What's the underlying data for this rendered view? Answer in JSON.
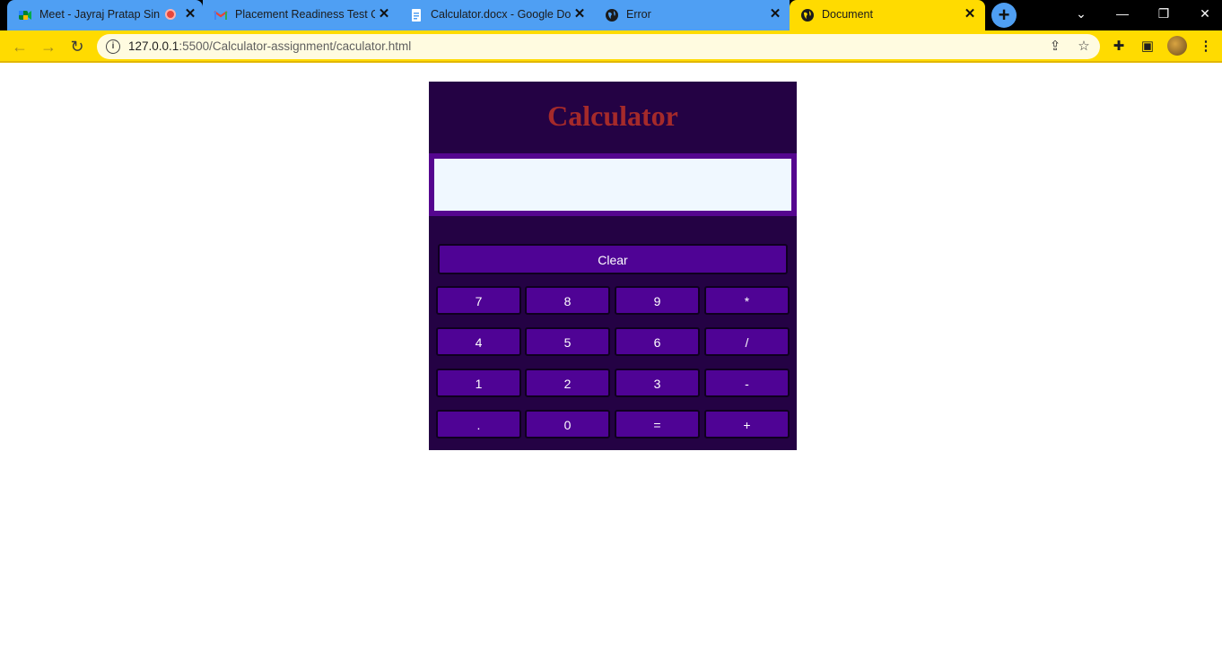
{
  "browser": {
    "tabs": [
      {
        "title": "Meet - Jayraj Pratap Singh",
        "icon": "google-meet-icon",
        "recording": true
      },
      {
        "title": "Placement Readiness Test Qu",
        "icon": "gmail-icon"
      },
      {
        "title": "Calculator.docx - Google Docs",
        "icon": "docs-icon"
      },
      {
        "title": "Error",
        "icon": "globe-icon"
      },
      {
        "title": "Document",
        "icon": "globe-icon",
        "active": true
      }
    ],
    "url_host": "127.0.0.1",
    "url_rest": ":5500/Calculator-assignment/caculator.html",
    "colors": {
      "tab_strip": "#000000",
      "tab": "#4f9ff3",
      "active_tab": "#ffdb00",
      "toolbar": "#ffdb00"
    }
  },
  "calculator": {
    "title": "Calculator",
    "display_value": "",
    "clear_label": "Clear",
    "rows": [
      [
        "7",
        "8",
        "9",
        "*"
      ],
      [
        "4",
        "5",
        "6",
        "/"
      ],
      [
        "1",
        "2",
        "3",
        "-"
      ],
      [
        ".",
        "0",
        "=",
        "+"
      ]
    ],
    "colors": {
      "panel": "#240244",
      "button": "#4f0395",
      "title": "#a52a2a",
      "display": "#f0f8ff",
      "display_border": "#55068f"
    }
  }
}
